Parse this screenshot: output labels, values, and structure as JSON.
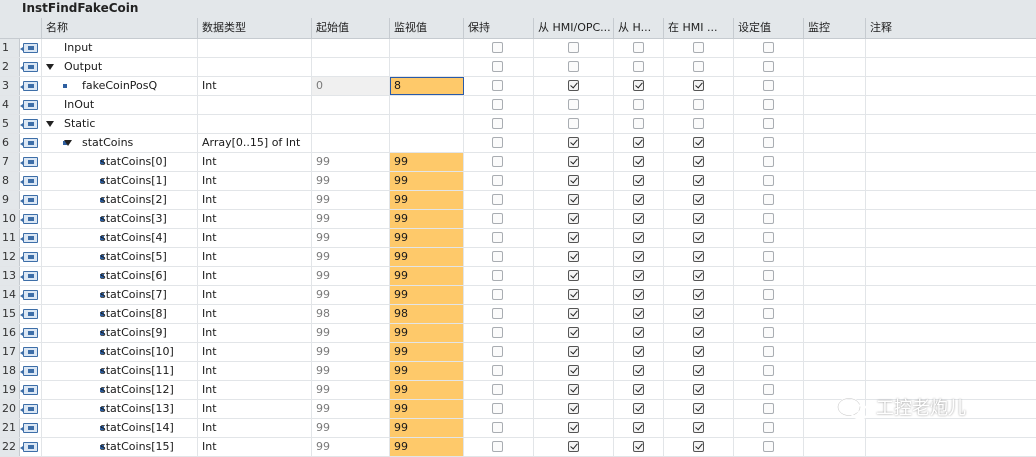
{
  "window": {
    "title": "InstFindFakeCoin"
  },
  "columns": {
    "name": "名称",
    "type": "数据类型",
    "start": "起始值",
    "monitor": "监视值",
    "retain": "保持",
    "hmi_opc": "从 HMI/OPC...",
    "hmi_h": "从 H...",
    "hmi_in": "在 HMI ...",
    "setpoint": "设定值",
    "supervision": "监控",
    "comment": "注释"
  },
  "rows": [
    {
      "num": "1",
      "name": "Input",
      "type": "",
      "start": "",
      "monitor": "",
      "indent": 0,
      "expand": false,
      "bullet": false,
      "cbs": [
        0,
        0,
        0,
        0,
        0
      ],
      "mon_hl": false,
      "start_hl": false,
      "selected": false
    },
    {
      "num": "2",
      "name": "Output",
      "type": "",
      "start": "",
      "monitor": "",
      "indent": 0,
      "expand": true,
      "bullet": false,
      "cbs": [
        0,
        0,
        0,
        0,
        0
      ],
      "mon_hl": false,
      "start_hl": false,
      "selected": false
    },
    {
      "num": "3",
      "name": "fakeCoinPosQ",
      "type": "Int",
      "start": "0",
      "monitor": "8",
      "indent": 1,
      "expand": false,
      "bullet": true,
      "cbs": [
        0,
        1,
        1,
        1,
        0
      ],
      "mon_hl": true,
      "start_hl": true,
      "selected": true
    },
    {
      "num": "4",
      "name": "InOut",
      "type": "",
      "start": "",
      "monitor": "",
      "indent": 0,
      "expand": false,
      "bullet": false,
      "cbs": [
        0,
        0,
        0,
        0,
        0
      ],
      "mon_hl": false,
      "start_hl": false,
      "selected": false
    },
    {
      "num": "5",
      "name": "Static",
      "type": "",
      "start": "",
      "monitor": "",
      "indent": 0,
      "expand": true,
      "bullet": false,
      "cbs": [
        0,
        0,
        0,
        0,
        0
      ],
      "mon_hl": false,
      "start_hl": false,
      "selected": false
    },
    {
      "num": "6",
      "name": "statCoins",
      "type": "Array[0..15] of Int",
      "start": "",
      "monitor": "",
      "indent": 1,
      "expand": true,
      "bullet": true,
      "cbs": [
        0,
        1,
        1,
        1,
        0
      ],
      "mon_hl": false,
      "start_hl": false,
      "selected": false
    },
    {
      "num": "7",
      "name": "statCoins[0]",
      "type": "Int",
      "start": "99",
      "monitor": "99",
      "indent": 2,
      "expand": false,
      "bullet": true,
      "cbs": [
        0,
        1,
        1,
        1,
        0
      ],
      "mon_hl": true,
      "start_hl": false,
      "selected": false
    },
    {
      "num": "8",
      "name": "statCoins[1]",
      "type": "Int",
      "start": "99",
      "monitor": "99",
      "indent": 2,
      "expand": false,
      "bullet": true,
      "cbs": [
        0,
        1,
        1,
        1,
        0
      ],
      "mon_hl": true,
      "start_hl": false,
      "selected": false
    },
    {
      "num": "9",
      "name": "statCoins[2]",
      "type": "Int",
      "start": "99",
      "monitor": "99",
      "indent": 2,
      "expand": false,
      "bullet": true,
      "cbs": [
        0,
        1,
        1,
        1,
        0
      ],
      "mon_hl": true,
      "start_hl": false,
      "selected": false
    },
    {
      "num": "10",
      "name": "statCoins[3]",
      "type": "Int",
      "start": "99",
      "monitor": "99",
      "indent": 2,
      "expand": false,
      "bullet": true,
      "cbs": [
        0,
        1,
        1,
        1,
        0
      ],
      "mon_hl": true,
      "start_hl": false,
      "selected": false
    },
    {
      "num": "11",
      "name": "statCoins[4]",
      "type": "Int",
      "start": "99",
      "monitor": "99",
      "indent": 2,
      "expand": false,
      "bullet": true,
      "cbs": [
        0,
        1,
        1,
        1,
        0
      ],
      "mon_hl": true,
      "start_hl": false,
      "selected": false
    },
    {
      "num": "12",
      "name": "statCoins[5]",
      "type": "Int",
      "start": "99",
      "monitor": "99",
      "indent": 2,
      "expand": false,
      "bullet": true,
      "cbs": [
        0,
        1,
        1,
        1,
        0
      ],
      "mon_hl": true,
      "start_hl": false,
      "selected": false
    },
    {
      "num": "13",
      "name": "statCoins[6]",
      "type": "Int",
      "start": "99",
      "monitor": "99",
      "indent": 2,
      "expand": false,
      "bullet": true,
      "cbs": [
        0,
        1,
        1,
        1,
        0
      ],
      "mon_hl": true,
      "start_hl": false,
      "selected": false
    },
    {
      "num": "14",
      "name": "statCoins[7]",
      "type": "Int",
      "start": "99",
      "monitor": "99",
      "indent": 2,
      "expand": false,
      "bullet": true,
      "cbs": [
        0,
        1,
        1,
        1,
        0
      ],
      "mon_hl": true,
      "start_hl": false,
      "selected": false
    },
    {
      "num": "15",
      "name": "statCoins[8]",
      "type": "Int",
      "start": "98",
      "monitor": "98",
      "indent": 2,
      "expand": false,
      "bullet": true,
      "cbs": [
        0,
        1,
        1,
        1,
        0
      ],
      "mon_hl": true,
      "start_hl": false,
      "selected": false
    },
    {
      "num": "16",
      "name": "statCoins[9]",
      "type": "Int",
      "start": "99",
      "monitor": "99",
      "indent": 2,
      "expand": false,
      "bullet": true,
      "cbs": [
        0,
        1,
        1,
        1,
        0
      ],
      "mon_hl": true,
      "start_hl": false,
      "selected": false
    },
    {
      "num": "17",
      "name": "statCoins[10]",
      "type": "Int",
      "start": "99",
      "monitor": "99",
      "indent": 2,
      "expand": false,
      "bullet": true,
      "cbs": [
        0,
        1,
        1,
        1,
        0
      ],
      "mon_hl": true,
      "start_hl": false,
      "selected": false
    },
    {
      "num": "18",
      "name": "statCoins[11]",
      "type": "Int",
      "start": "99",
      "monitor": "99",
      "indent": 2,
      "expand": false,
      "bullet": true,
      "cbs": [
        0,
        1,
        1,
        1,
        0
      ],
      "mon_hl": true,
      "start_hl": false,
      "selected": false
    },
    {
      "num": "19",
      "name": "statCoins[12]",
      "type": "Int",
      "start": "99",
      "monitor": "99",
      "indent": 2,
      "expand": false,
      "bullet": true,
      "cbs": [
        0,
        1,
        1,
        1,
        0
      ],
      "mon_hl": true,
      "start_hl": false,
      "selected": false
    },
    {
      "num": "20",
      "name": "statCoins[13]",
      "type": "Int",
      "start": "99",
      "monitor": "99",
      "indent": 2,
      "expand": false,
      "bullet": true,
      "cbs": [
        0,
        1,
        1,
        1,
        0
      ],
      "mon_hl": true,
      "start_hl": false,
      "selected": false
    },
    {
      "num": "21",
      "name": "statCoins[14]",
      "type": "Int",
      "start": "99",
      "monitor": "99",
      "indent": 2,
      "expand": false,
      "bullet": true,
      "cbs": [
        0,
        1,
        1,
        1,
        0
      ],
      "mon_hl": true,
      "start_hl": false,
      "selected": false
    },
    {
      "num": "22",
      "name": "statCoins[15]",
      "type": "Int",
      "start": "99",
      "monitor": "99",
      "indent": 2,
      "expand": false,
      "bullet": true,
      "cbs": [
        0,
        1,
        1,
        1,
        0
      ],
      "mon_hl": true,
      "start_hl": false,
      "selected": false
    }
  ],
  "watermark": {
    "text": "工控老炮儿",
    "icon": "wechat-icon"
  },
  "colors": {
    "monitor_highlight": "#fec96a",
    "selection_outline": "#2a5aa8",
    "header_bg": "#e3e7ea"
  }
}
